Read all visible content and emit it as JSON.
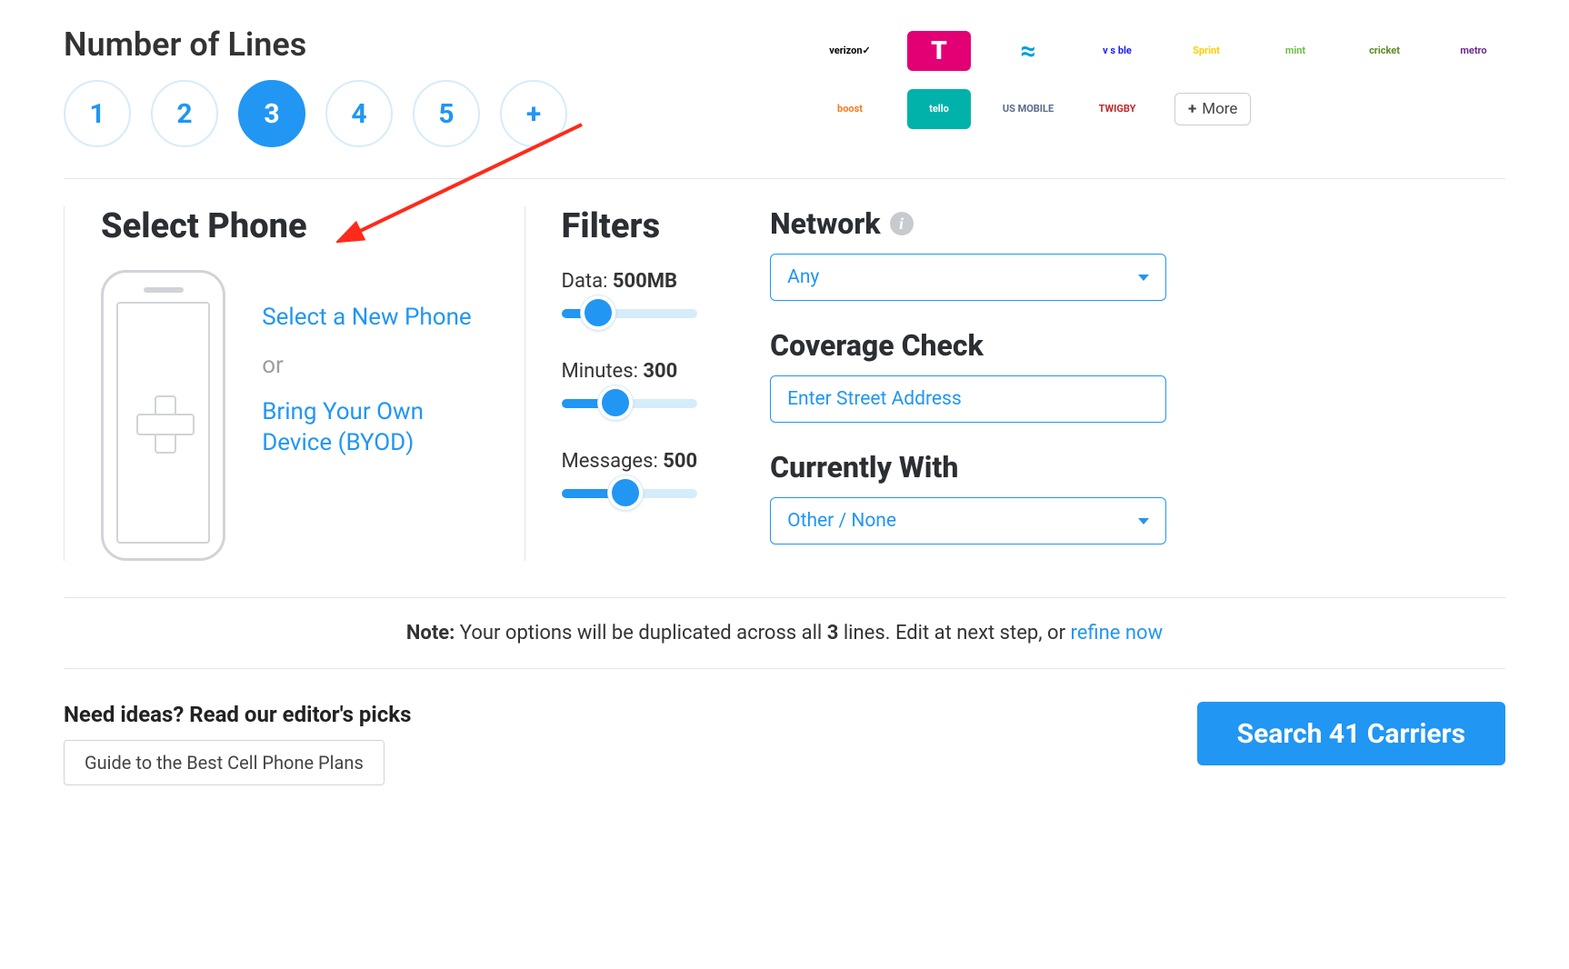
{
  "lines": {
    "heading": "Number of Lines",
    "options": [
      "1",
      "2",
      "3",
      "4",
      "5",
      "+"
    ],
    "selected_index": 2
  },
  "carriers": {
    "row1": [
      {
        "name": "verizon",
        "label": "verizon✓",
        "bg": "#fff",
        "color": "#000"
      },
      {
        "name": "tmobile",
        "label": "T",
        "bg": "#e20074",
        "color": "#fff"
      },
      {
        "name": "att",
        "label": "≈",
        "bg": "#fff",
        "color": "#009fdb"
      },
      {
        "name": "visible",
        "label": "v s ble",
        "bg": "#fff",
        "color": "#1a1aff"
      },
      {
        "name": "sprint",
        "label": "Sprint",
        "bg": "#fff",
        "color": "#ffce00"
      },
      {
        "name": "mint",
        "label": "mint",
        "bg": "#fff",
        "color": "#6fbf44"
      },
      {
        "name": "cricket",
        "label": "cricket",
        "bg": "#fff",
        "color": "#5a8a22"
      },
      {
        "name": "metro",
        "label": "metro",
        "bg": "#fff",
        "color": "#6b2d90"
      }
    ],
    "row2": [
      {
        "name": "boost",
        "label": "boost",
        "bg": "#fff",
        "color": "#f47b20"
      },
      {
        "name": "tello",
        "label": "tello",
        "bg": "#00b2a9",
        "color": "#fff"
      },
      {
        "name": "usmobile",
        "label": "US MOBILE",
        "bg": "#fff",
        "color": "#5b6a8a"
      },
      {
        "name": "twigby",
        "label": "TWIGBY",
        "bg": "#fff",
        "color": "#c1272d"
      }
    ],
    "more_label": "More"
  },
  "select_phone": {
    "heading": "Select Phone",
    "new_phone": "Select a New Phone",
    "or": "or",
    "byod": "Bring Your Own Device (BYOD)"
  },
  "filters": {
    "heading": "Filters",
    "data": {
      "label": "Data:",
      "value": "500MB",
      "percent": 27
    },
    "minutes": {
      "label": "Minutes:",
      "value": "300",
      "percent": 40
    },
    "messages": {
      "label": "Messages:",
      "value": "500",
      "percent": 47
    }
  },
  "network": {
    "heading": "Network",
    "selected": "Any"
  },
  "coverage": {
    "heading": "Coverage Check",
    "placeholder": "Enter Street Address"
  },
  "currently": {
    "heading": "Currently With",
    "selected": "Other / None"
  },
  "note": {
    "prefix": "Note:",
    "text_a": " Your options will be duplicated across all ",
    "lines": "3",
    "text_b": " lines. Edit at next step, or ",
    "link": "refine now"
  },
  "ideas": {
    "heading": "Need ideas? Read our editor's picks",
    "button": "Guide to the Best Cell Phone Plans"
  },
  "search": {
    "button": "Search 41 Carriers"
  }
}
